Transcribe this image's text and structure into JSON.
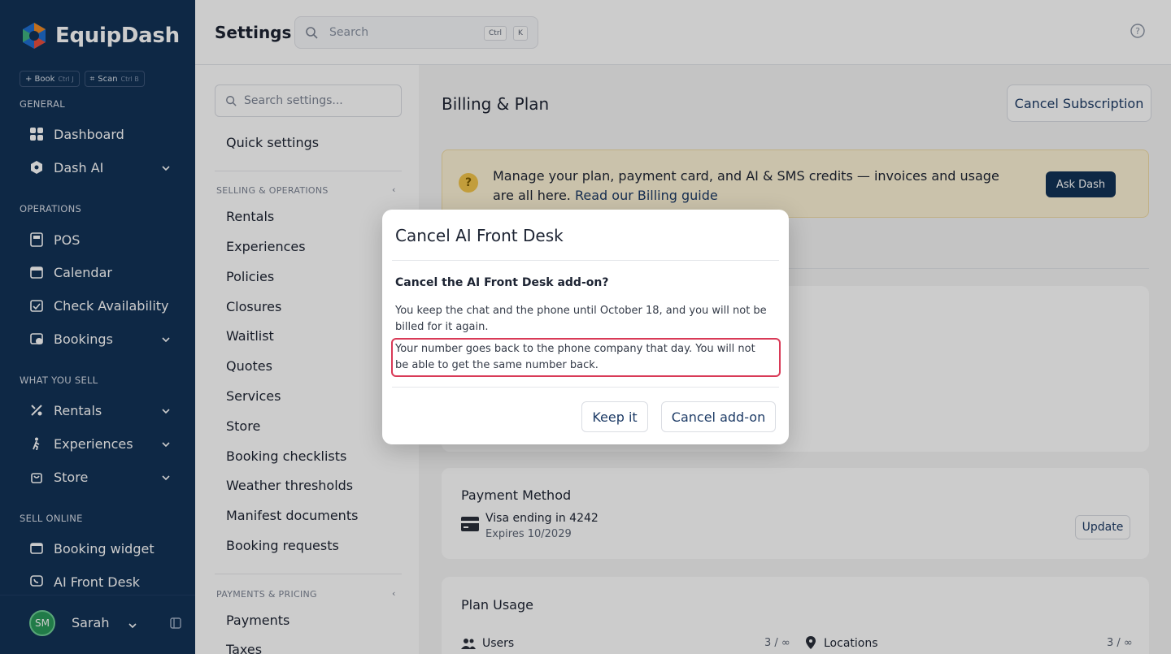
{
  "app": {
    "name": "EquipDash"
  },
  "quick_actions": [
    {
      "label": "+ Book",
      "shortcut": "Ctrl J"
    },
    {
      "label": "Scan",
      "shortcut": "Ctrl B"
    }
  ],
  "sidebar": {
    "sections": {
      "general": "GENERAL",
      "operations": "OPERATIONS",
      "what_you_sell": "WHAT YOU SELL",
      "sell_online": "SELL ONLINE"
    },
    "items": {
      "dashboard": "Dashboard",
      "dash_ai": "Dash AI",
      "pos": "POS",
      "calendar": "Calendar",
      "check_availability": "Check Availability",
      "bookings": "Bookings",
      "rentals": "Rentals",
      "experiences": "Experiences",
      "store": "Store",
      "booking_widget": "Booking widget",
      "ai_front_desk": "AI Front Desk"
    },
    "user": {
      "initials": "SM",
      "name": "Sarah"
    }
  },
  "header": {
    "title": "Settings",
    "search_placeholder": "Search",
    "kbd_ctrl": "Ctrl",
    "kbd_k": "K"
  },
  "settings_nav": {
    "search_placeholder": "Search settings...",
    "quick_settings": "Quick settings",
    "selling_header": "SELLING & OPERATIONS",
    "selling_items": [
      "Rentals",
      "Experiences",
      "Policies",
      "Closures",
      "Waitlist",
      "Quotes",
      "Services",
      "Store",
      "Booking checklists",
      "Weather thresholds",
      "Manifest documents",
      "Booking requests"
    ],
    "payments_header": "PAYMENTS & PRICING",
    "payments_items": [
      "Payments",
      "Taxes"
    ]
  },
  "main": {
    "title": "Billing & Plan",
    "cancel_subscription": "Cancel Subscription",
    "banner_text": "Manage your plan, payment card, and AI & SMS credits — invoices and usage are all here.",
    "banner_link": "Read our Billing guide",
    "ask_dash": "Ask Dash",
    "payment": {
      "title": "Payment Method",
      "card": "Visa ending in 4242",
      "expires": "Expires 10/2029",
      "update": "Update"
    },
    "usage": {
      "title": "Plan Usage",
      "users_label": "Users",
      "users_value": "3 / ∞",
      "locations_label": "Locations",
      "locations_value": "3 / ∞"
    }
  },
  "modal": {
    "title": "Cancel AI Front Desk",
    "question": "Cancel the AI Front Desk add-on?",
    "para1": "You keep the chat and the phone until October 18, and you will not be billed for it again.",
    "para2": "Your number goes back to the phone company that day. You will not be able to get the same number back.",
    "keep": "Keep it",
    "cancel": "Cancel add-on"
  }
}
